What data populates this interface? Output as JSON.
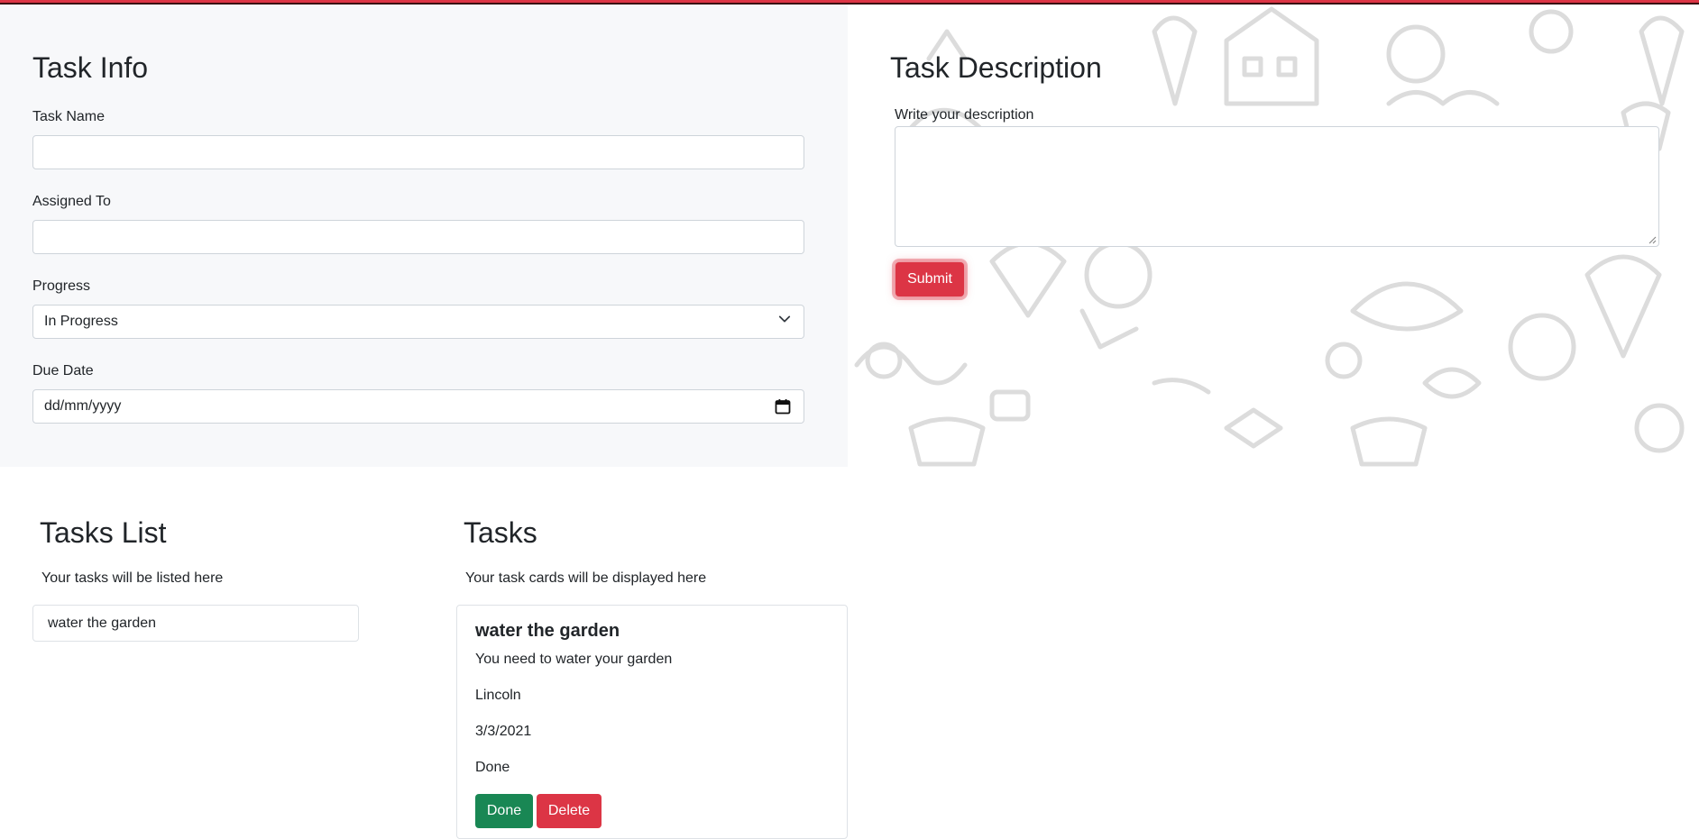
{
  "colors": {
    "accent_red": "#dc3545",
    "success_green": "#198754",
    "panel_bg": "#f7f8fa",
    "border": "#ced4da"
  },
  "task_info": {
    "title": "Task Info",
    "task_name": {
      "label": "Task Name",
      "value": ""
    },
    "assigned_to": {
      "label": "Assigned To",
      "value": ""
    },
    "progress": {
      "label": "Progress",
      "selected": "In Progress",
      "icon": "chevron-down-icon"
    },
    "due_date": {
      "label": "Due Date",
      "placeholder": "dd/mm/yyyy",
      "icon": "calendar-icon"
    }
  },
  "task_description": {
    "title": "Task Description",
    "label": "Write your description",
    "value": "",
    "submit_label": "Submit"
  },
  "tasks_list": {
    "title": "Tasks List",
    "subtitle": "Your tasks will be listed here",
    "items": [
      "water the garden"
    ]
  },
  "tasks": {
    "title": "Tasks",
    "subtitle": "Your task cards will be displayed here",
    "cards": [
      {
        "name": "water the garden",
        "description": "You need to water your garden",
        "assigned_to": "Lincoln",
        "due_date": "3/3/2021",
        "status": "Done",
        "done_label": "Done",
        "delete_label": "Delete"
      }
    ]
  }
}
